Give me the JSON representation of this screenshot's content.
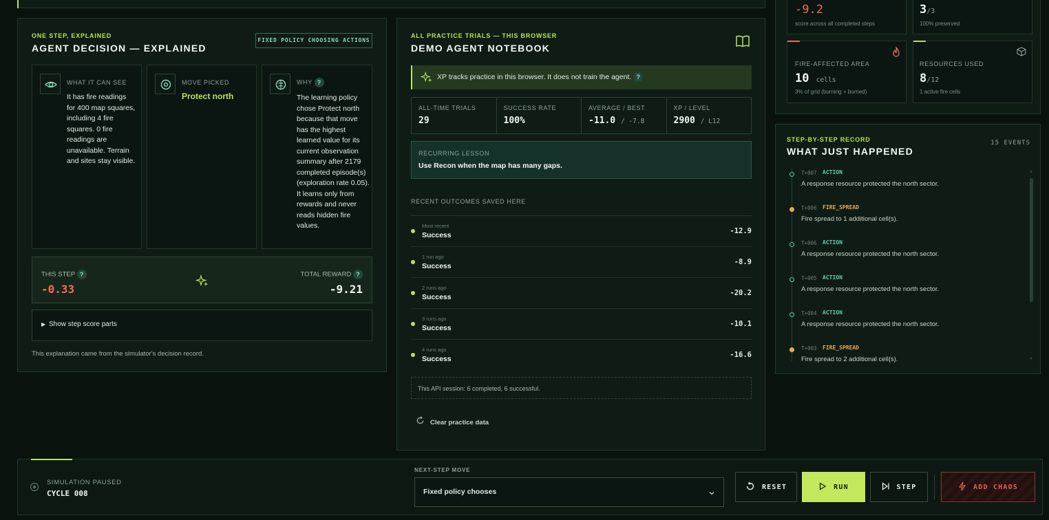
{
  "decision": {
    "eyebrow": "ONE STEP, EXPLAINED",
    "title": "AGENT DECISION — EXPLAINED",
    "badge": "FIXED POLICY CHOOSING ACTIONS",
    "see_label": "WHAT IT CAN SEE",
    "see_text": "It has fire readings for 400 map squares, including 4 fire squares. 0 fire readings are unavailable. Terrain and sites stay visible.",
    "move_label": "MOVE PICKED",
    "move_value": "Protect north",
    "why_label": "WHY",
    "why_text": "The learning policy chose Protect north because that move has the highest learned value for its current observation summary after 2179 completed episode(s) (exploration rate 0.05). It learns only from rewards and never reads hidden fire values.",
    "this_step_label": "THIS STEP",
    "this_step_value": "-0.33",
    "total_reward_label": "TOTAL REWARD",
    "total_reward_value": "-9.21",
    "score_parts": "Show step score parts",
    "footnote": "This explanation came from the simulator's decision record."
  },
  "notebook": {
    "eyebrow": "ALL PRACTICE TRIALS — THIS BROWSER",
    "title": "DEMO AGENT NOTEBOOK",
    "banner": "XP tracks practice in this browser. It does not train the agent.",
    "stats": [
      {
        "label": "ALL-TIME TRIALS",
        "value": "29",
        "sub": ""
      },
      {
        "label": "SUCCESS RATE",
        "value": "100%",
        "sub": ""
      },
      {
        "label": "AVERAGE / BEST",
        "value": "-11.0",
        "sub": "/ -7.8"
      },
      {
        "label": "XP / LEVEL",
        "value": "2900",
        "sub": "/ L12"
      }
    ],
    "lesson_label": "RECURRING LESSON",
    "lesson_text": "Use Recon when the map has many gaps.",
    "outcomes_label": "RECENT OUTCOMES SAVED HERE",
    "outcomes": [
      {
        "when": "Most recent",
        "result": "Success",
        "score": "-12.9"
      },
      {
        "when": "1 run ago",
        "result": "Success",
        "score": "-8.9"
      },
      {
        "when": "2 runs ago",
        "result": "Success",
        "score": "-20.2"
      },
      {
        "when": "3 runs ago",
        "result": "Success",
        "score": "-10.1"
      },
      {
        "when": "4 runs ago",
        "result": "Success",
        "score": "-16.6"
      }
    ],
    "session": "This API session: 6 completed, 6 successful.",
    "clear": "Clear practice data"
  },
  "metrics": {
    "score_value": "-9.2",
    "score_sub": "score across all completed steps",
    "preserved_value": "3",
    "preserved_of": "/3",
    "preserved_sub": "100% preserved",
    "fire_label": "FIRE-AFFECTED AREA",
    "fire_value": "10",
    "fire_unit": "cells",
    "fire_sub": "3% of grid (burning + burned)",
    "res_label": "RESOURCES USED",
    "res_value": "8",
    "res_of": "/12",
    "res_sub": "1 active fire cells"
  },
  "record": {
    "eyebrow": "STEP-BY-STEP RECORD",
    "title": "WHAT JUST HAPPENED",
    "count": "15 EVENTS",
    "events": [
      {
        "t": "T+007",
        "type": "ACTION",
        "text": "A response resource protected the north sector."
      },
      {
        "t": "T+006",
        "type": "FIRE_SPREAD",
        "text": "Fire spread to 1 additional cell(s)."
      },
      {
        "t": "T+006",
        "type": "ACTION",
        "text": "A response resource protected the north sector."
      },
      {
        "t": "T+005",
        "type": "ACTION",
        "text": "A response resource protected the north sector."
      },
      {
        "t": "T+004",
        "type": "ACTION",
        "text": "A response resource protected the north sector."
      },
      {
        "t": "T+003",
        "type": "FIRE_SPREAD",
        "text": "Fire spread to 2 additional cell(s)."
      }
    ]
  },
  "controls": {
    "status_label": "SIMULATION PAUSED",
    "cycle": "CYCLE 008",
    "next_label": "NEXT-STEP MOVE",
    "select_value": "Fixed policy chooses",
    "reset": "RESET",
    "run": "RUN",
    "step": "STEP",
    "chaos": "ADD CHAOS"
  },
  "colors": {
    "accent": "#b8e35a",
    "danger": "#f26b5b",
    "fire": "#e8a857",
    "action": "#5fd0b0"
  }
}
